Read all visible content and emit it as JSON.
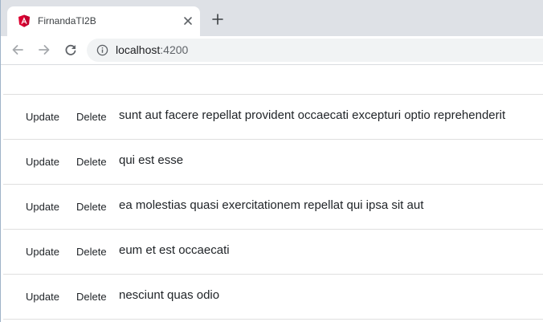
{
  "browser": {
    "tab": {
      "title": "FirnandaTI2B",
      "favicon": "angular-icon"
    },
    "address": {
      "host": "localhost",
      "port": ":4200"
    }
  },
  "posts": {
    "update_label": "Update",
    "delete_label": "Delete",
    "items": [
      {
        "title": "sunt aut facere repellat provident occaecati excepturi optio reprehenderit"
      },
      {
        "title": "qui est esse"
      },
      {
        "title": "ea molestias quasi exercitationem repellat qui ipsa sit aut"
      },
      {
        "title": "eum et est occaecati"
      },
      {
        "title": "nesciunt quas odio"
      }
    ]
  },
  "colors": {
    "tabstrip": "#dee1e6",
    "omnibox": "#f1f3f4",
    "angular_red": "#dd0031",
    "text": "#212529",
    "divider": "#dfdfdf"
  }
}
